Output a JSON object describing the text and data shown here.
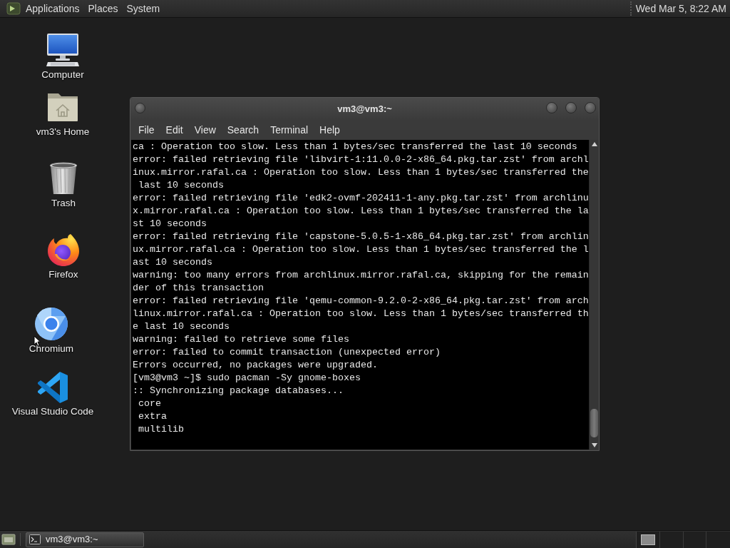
{
  "top_panel": {
    "menus": [
      "Applications",
      "Places",
      "System"
    ],
    "clock": "Wed Mar 5, 8:22 AM"
  },
  "desktop_icons": [
    {
      "kind": "computer",
      "label": "Computer"
    },
    {
      "kind": "home",
      "label": "vm3's Home"
    },
    {
      "kind": "trash",
      "label": "Trash"
    },
    {
      "kind": "firefox",
      "label": "Firefox"
    },
    {
      "kind": "chromium",
      "label": "Chromium"
    },
    {
      "kind": "vscode",
      "label": "Visual Studio Code"
    }
  ],
  "terminal_window": {
    "title": "vm3@vm3:~",
    "menu": [
      "File",
      "Edit",
      "View",
      "Search",
      "Terminal",
      "Help"
    ],
    "lines": [
      "ca : Operation too slow. Less than 1 bytes/sec transferred the last 10 seconds",
      "error: failed retrieving file 'libvirt-1:11.0.0-2-x86_64.pkg.tar.zst' from archl",
      "inux.mirror.rafal.ca : Operation too slow. Less than 1 bytes/sec transferred the",
      " last 10 seconds",
      "error: failed retrieving file 'edk2-ovmf-202411-1-any.pkg.tar.zst' from archlinu",
      "x.mirror.rafal.ca : Operation too slow. Less than 1 bytes/sec transferred the la",
      "st 10 seconds",
      "error: failed retrieving file 'capstone-5.0.5-1-x86_64.pkg.tar.zst' from archlin",
      "ux.mirror.rafal.ca : Operation too slow. Less than 1 bytes/sec transferred the l",
      "ast 10 seconds",
      "warning: too many errors from archlinux.mirror.rafal.ca, skipping for the remain",
      "der of this transaction",
      "error: failed retrieving file 'qemu-common-9.2.0-2-x86_64.pkg.tar.zst' from arch",
      "linux.mirror.rafal.ca : Operation too slow. Less than 1 bytes/sec transferred th",
      "e last 10 seconds",
      "warning: failed to retrieve some files",
      "error: failed to commit transaction (unexpected error)",
      "Errors occurred, no packages were upgraded.",
      "[vm3@vm3 ~]$ sudo pacman -Sy gnome-boxes",
      ":: Synchronizing package databases...",
      " core",
      " extra",
      " multilib"
    ]
  },
  "taskbar": {
    "tasks": [
      {
        "label": "vm3@vm3:~",
        "selected": true
      }
    ]
  }
}
